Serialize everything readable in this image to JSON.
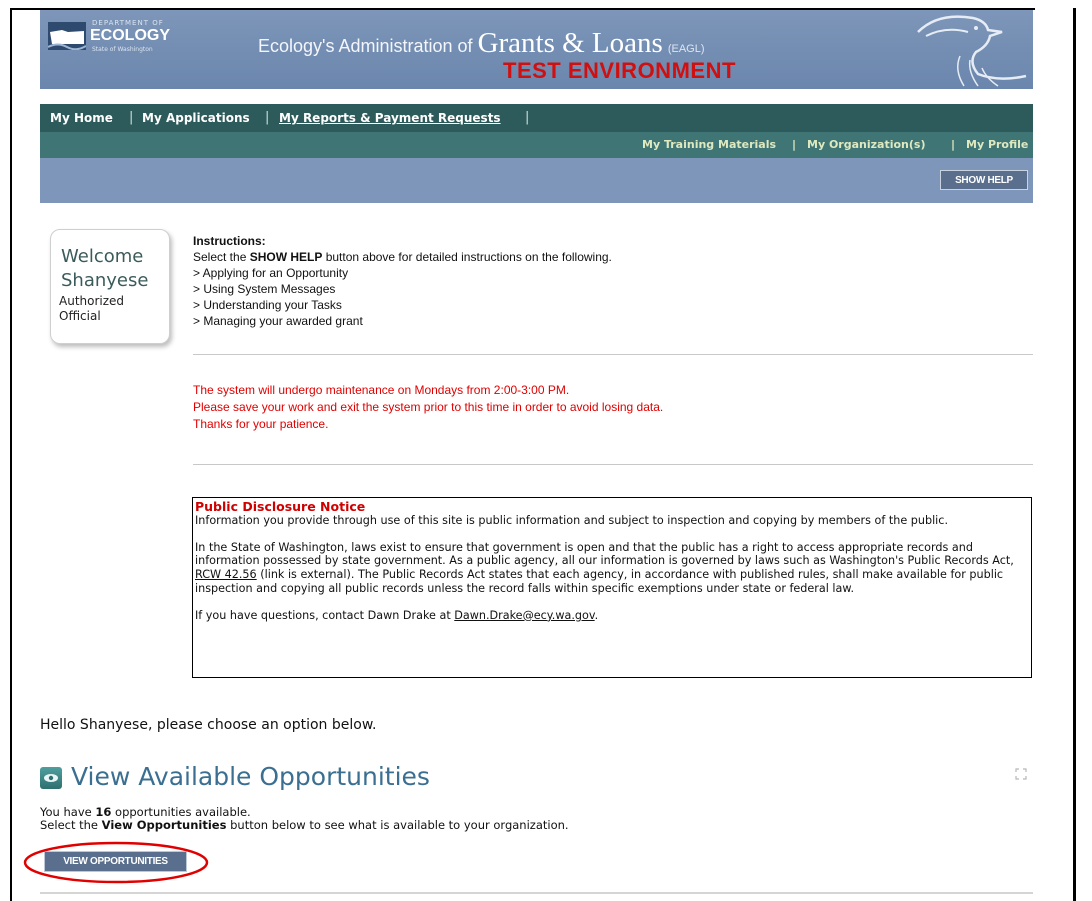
{
  "header": {
    "dept_label": "DEPARTMENT OF",
    "org_name": "ECOLOGY",
    "state_label": "State of Washington",
    "title_prefix": "Ecology's Administration of",
    "title_main": "Grants & Loans",
    "title_abbrev": "(EAGL)",
    "environment": "TEST ENVIRONMENT"
  },
  "nav_primary": [
    {
      "label": "My Home"
    },
    {
      "label": "My Applications"
    },
    {
      "label": "My Reports & Payment Requests"
    }
  ],
  "nav_secondary": [
    {
      "label": "My Training Materials"
    },
    {
      "label": "My Organization(s)"
    },
    {
      "label": "My Profile"
    }
  ],
  "nav_separator": "|",
  "help_button": "SHOW HELP",
  "welcome": {
    "greeting": "Welcome",
    "name": "Shanyese",
    "role": "Authorized Official"
  },
  "instructions": {
    "heading": "Instructions:",
    "intro_prefix": "Select the ",
    "intro_bold": "SHOW HELP",
    "intro_suffix": " button above for detailed instructions on the following.",
    "items": [
      "> Applying for an Opportunity",
      "> Using System Messages",
      "> Understanding your Tasks",
      "> Managing your awarded grant"
    ]
  },
  "maintenance": [
    "The system will undergo maintenance on Mondays from 2:00-3:00 PM.",
    "Please save your work and exit the system prior to this time in order to avoid losing data.",
    "Thanks for your patience."
  ],
  "disclosure": {
    "title": "Public Disclosure Notice",
    "p1": "Information you provide through use of this site is public information and subject to inspection and copying by members of the public.",
    "p2_before": "In the State of Washington, laws exist to ensure that government is open and that the public has a right to access appropriate records and information possessed by state government. As a public agency, all our information is governed by laws such as Washington's Public Records Act, ",
    "p2_link": "RCW 42.56",
    "p2_after": " (link is external). The Public Records Act states that each agency, in accordance with published rules, shall make available for public inspection and copying all public records unless the record falls within specific exemptions under state or federal law.",
    "p3_before": "If you have questions, contact Dawn Drake at ",
    "p3_email": "Dawn.Drake@ecy.wa.gov",
    "p3_after": "."
  },
  "hello_text": "Hello Shanyese, please choose an option below.",
  "opportunities": {
    "title": "View Available Opportunities",
    "count_prefix": "You have ",
    "count": "16",
    "count_suffix": " opportunities available.",
    "desc_prefix": "Select the ",
    "desc_bold": "View Opportunities",
    "desc_suffix": " button below to see what is available to your organization.",
    "button": "VIEW OPPORTUNITIES"
  },
  "colors": {
    "banner": "#7d96b9",
    "nav_dark": "#2d5b5b",
    "nav_mid": "#3f7575",
    "alert_red": "#e00000",
    "title_blue": "#3b6f91",
    "annotation_circle": "#e00000"
  }
}
